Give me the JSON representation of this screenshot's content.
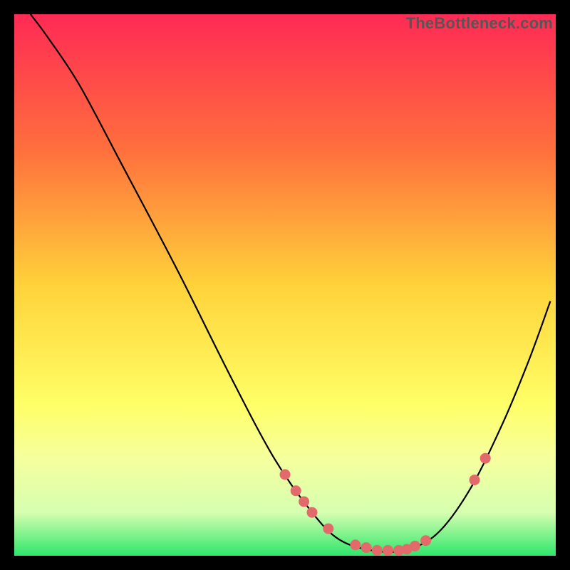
{
  "watermark": "TheBottleneck.com",
  "chart_data": {
    "type": "line",
    "title": "",
    "xlabel": "",
    "ylabel": "",
    "xlim": [
      0,
      100
    ],
    "ylim": [
      0,
      100
    ],
    "gradient_stops": [
      {
        "offset": 0,
        "color": "#ff2a55"
      },
      {
        "offset": 25,
        "color": "#ff6f3d"
      },
      {
        "offset": 50,
        "color": "#ffd23a"
      },
      {
        "offset": 72,
        "color": "#ffff66"
      },
      {
        "offset": 82,
        "color": "#f6ff9e"
      },
      {
        "offset": 92,
        "color": "#d6ffb0"
      },
      {
        "offset": 100,
        "color": "#2ee66b"
      }
    ],
    "series": [
      {
        "name": "bottleneck-curve",
        "points": [
          {
            "x": 3,
            "y": 100
          },
          {
            "x": 6,
            "y": 96
          },
          {
            "x": 12,
            "y": 87
          },
          {
            "x": 20,
            "y": 72
          },
          {
            "x": 30,
            "y": 53
          },
          {
            "x": 40,
            "y": 33
          },
          {
            "x": 48,
            "y": 18
          },
          {
            "x": 55,
            "y": 8
          },
          {
            "x": 60,
            "y": 3
          },
          {
            "x": 66,
            "y": 1
          },
          {
            "x": 72,
            "y": 1
          },
          {
            "x": 78,
            "y": 4
          },
          {
            "x": 84,
            "y": 12
          },
          {
            "x": 90,
            "y": 24
          },
          {
            "x": 95,
            "y": 36
          },
          {
            "x": 99,
            "y": 47
          }
        ]
      }
    ],
    "markers": [
      {
        "x": 50,
        "y": 15
      },
      {
        "x": 52,
        "y": 12
      },
      {
        "x": 53.5,
        "y": 10
      },
      {
        "x": 55,
        "y": 8
      },
      {
        "x": 58,
        "y": 5
      },
      {
        "x": 63,
        "y": 2
      },
      {
        "x": 65,
        "y": 1.5
      },
      {
        "x": 67,
        "y": 1
      },
      {
        "x": 69,
        "y": 1
      },
      {
        "x": 71,
        "y": 1
      },
      {
        "x": 72.5,
        "y": 1.2
      },
      {
        "x": 74,
        "y": 1.8
      },
      {
        "x": 76,
        "y": 2.8
      },
      {
        "x": 85,
        "y": 14
      },
      {
        "x": 87,
        "y": 18
      }
    ]
  }
}
